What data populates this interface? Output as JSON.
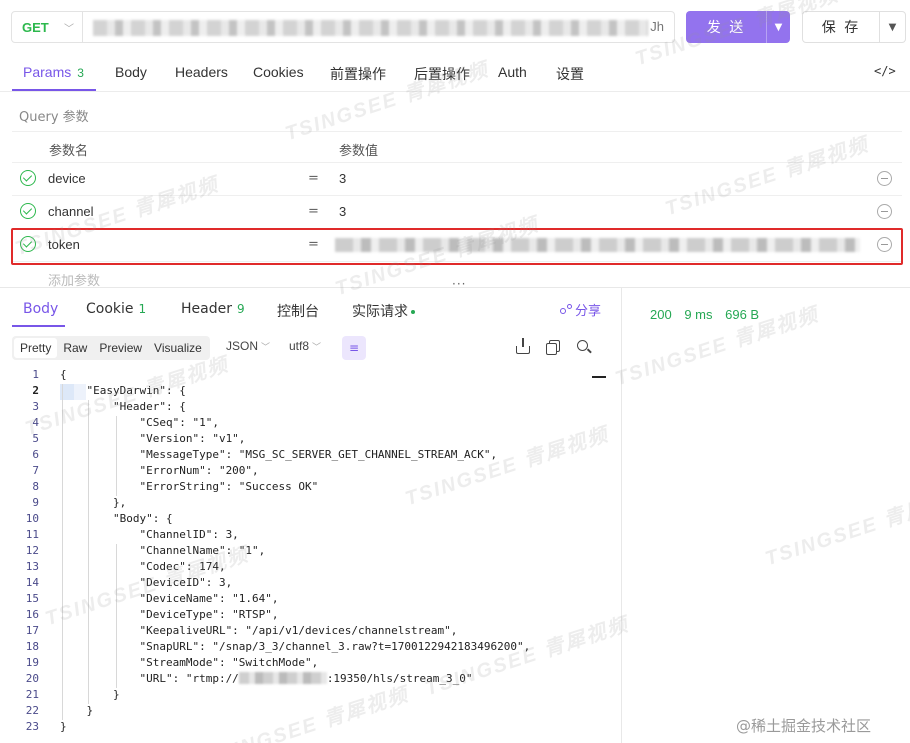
{
  "request": {
    "method": "GET",
    "url_tail": "Jh",
    "send_label": "发 送",
    "save_label": "保 存"
  },
  "request_tabs": [
    {
      "label": "Params",
      "count": "3"
    },
    {
      "label": "Body",
      "count": ""
    },
    {
      "label": "Headers",
      "count": ""
    },
    {
      "label": "Cookies",
      "count": ""
    },
    {
      "label": "前置操作",
      "count": ""
    },
    {
      "label": "后置操作",
      "count": ""
    },
    {
      "label": "Auth",
      "count": ""
    },
    {
      "label": "设置",
      "count": ""
    }
  ],
  "code_toggle": "</>",
  "query_label": "Query 参数",
  "params_table": {
    "col_name": "参数名",
    "col_value": "参数值",
    "rows": [
      {
        "name": "device",
        "value": "3"
      },
      {
        "name": "channel",
        "value": "3"
      },
      {
        "name": "token",
        "value": ""
      }
    ],
    "add_placeholder": "添加参数"
  },
  "drag_handle": "···",
  "response_tabs": [
    {
      "label": "Body",
      "count": ""
    },
    {
      "label": "Cookie",
      "count": "1"
    },
    {
      "label": "Header",
      "count": "9"
    },
    {
      "label": "控制台",
      "count": ""
    },
    {
      "label": "实际请求",
      "count": ""
    }
  ],
  "share_label": "分享",
  "format": {
    "buttons": [
      "Pretty",
      "Raw",
      "Preview",
      "Visualize"
    ],
    "lang": "JSON",
    "encoding": "utf8"
  },
  "response_stats": {
    "status": "200",
    "time": "9 ms",
    "size": "696 B"
  },
  "code_lines": [
    "{",
    "    \"EasyDarwin\": {",
    "        \"Header\": {",
    "            \"CSeq\": \"1\",",
    "            \"Version\": \"v1\",",
    "            \"MessageType\": \"MSG_SC_SERVER_GET_CHANNEL_STREAM_ACK\",",
    "            \"ErrorNum\": \"200\",",
    "            \"ErrorString\": \"Success OK\"",
    "        },",
    "        \"Body\": {",
    "            \"ChannelID\": 3,",
    "            \"ChannelName\": \"1\",",
    "            \"Codec\": 174,",
    "            \"DeviceID\": 3,",
    "            \"DeviceName\": \"1.64\",",
    "            \"DeviceType\": \"RTSP\",",
    "            \"KeepaliveURL\": \"/api/v1/devices/channelstream\",",
    "            \"SnapURL\": \"/snap/3_3/channel_3.raw?t=1700122942183496200\",",
    "            \"StreamMode\": \"SwitchMode\",",
    "            \"URL\": \"rtmp://",
    "        }",
    "    }",
    "}"
  ],
  "url_line_suffix": ":19350/hls/stream_3_0\"",
  "watermark_text": "TSINGSEE 青犀视频",
  "footer_watermark": "@稀土掘金技术社区"
}
